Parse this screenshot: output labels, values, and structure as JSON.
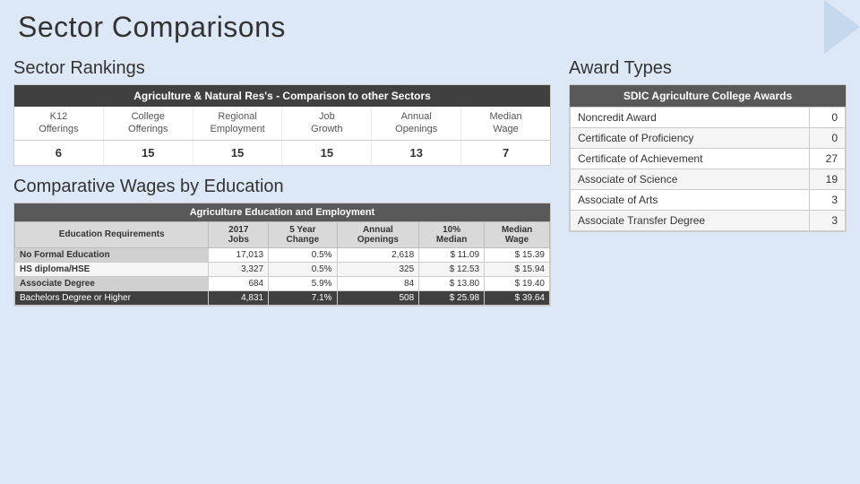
{
  "page": {
    "title": "Sector Comparisons"
  },
  "sector_rankings": {
    "section_title": "Sector Rankings",
    "table_header": "Agriculture & Natural Res's - Comparison to other Sectors",
    "columns": [
      {
        "label": "K12\nOfferings",
        "value": "6"
      },
      {
        "label": "College\nOfferings",
        "value": "15"
      },
      {
        "label": "Regional\nEmployment",
        "value": "15"
      },
      {
        "label": "Job\nGrowth",
        "value": "15"
      },
      {
        "label": "Annual\nOpenings",
        "value": "13"
      },
      {
        "label": "Median\nWage",
        "value": "7"
      }
    ]
  },
  "comparative_wages": {
    "section_title": "Comparative Wages by Education",
    "table_header": "Agriculture Education and Employment",
    "col_headers": [
      "Education Requirements",
      "2017\nJobs",
      "5 Year\nChange",
      "Annual\nOpenings",
      "10%\nMedian",
      "Median\nWage"
    ],
    "rows": [
      {
        "label": "No Formal Education",
        "jobs": "17,013",
        "change": "0.5%",
        "openings": "2,618",
        "median": "$ 11.09",
        "wage": "$ 15.39"
      },
      {
        "label": "HS diploma/HSE",
        "jobs": "3,327",
        "change": "0.5%",
        "openings": "325",
        "median": "$ 12.53",
        "wage": "$ 15.94"
      },
      {
        "label": "Associate Degree",
        "jobs": "684",
        "change": "5.9%",
        "openings": "84",
        "median": "$ 13.80",
        "wage": "$ 19.40"
      },
      {
        "label": "Bachelors Degree or Higher",
        "jobs": "4,831",
        "change": "7.1%",
        "openings": "508",
        "median": "$ 25.98",
        "wage": "$ 39.64"
      }
    ]
  },
  "award_types": {
    "section_title": "Award Types",
    "table_header": "SDIC Agriculture College Awards",
    "rows": [
      {
        "label": "Noncredit Award",
        "value": "0"
      },
      {
        "label": "Certificate of Proficiency",
        "value": "0"
      },
      {
        "label": "Certificate of Achievement",
        "value": "27"
      },
      {
        "label": "Associate of Science",
        "value": "19"
      },
      {
        "label": "Associate of Arts",
        "value": "3"
      },
      {
        "label": "Associate Transfer Degree",
        "value": "3"
      }
    ]
  }
}
